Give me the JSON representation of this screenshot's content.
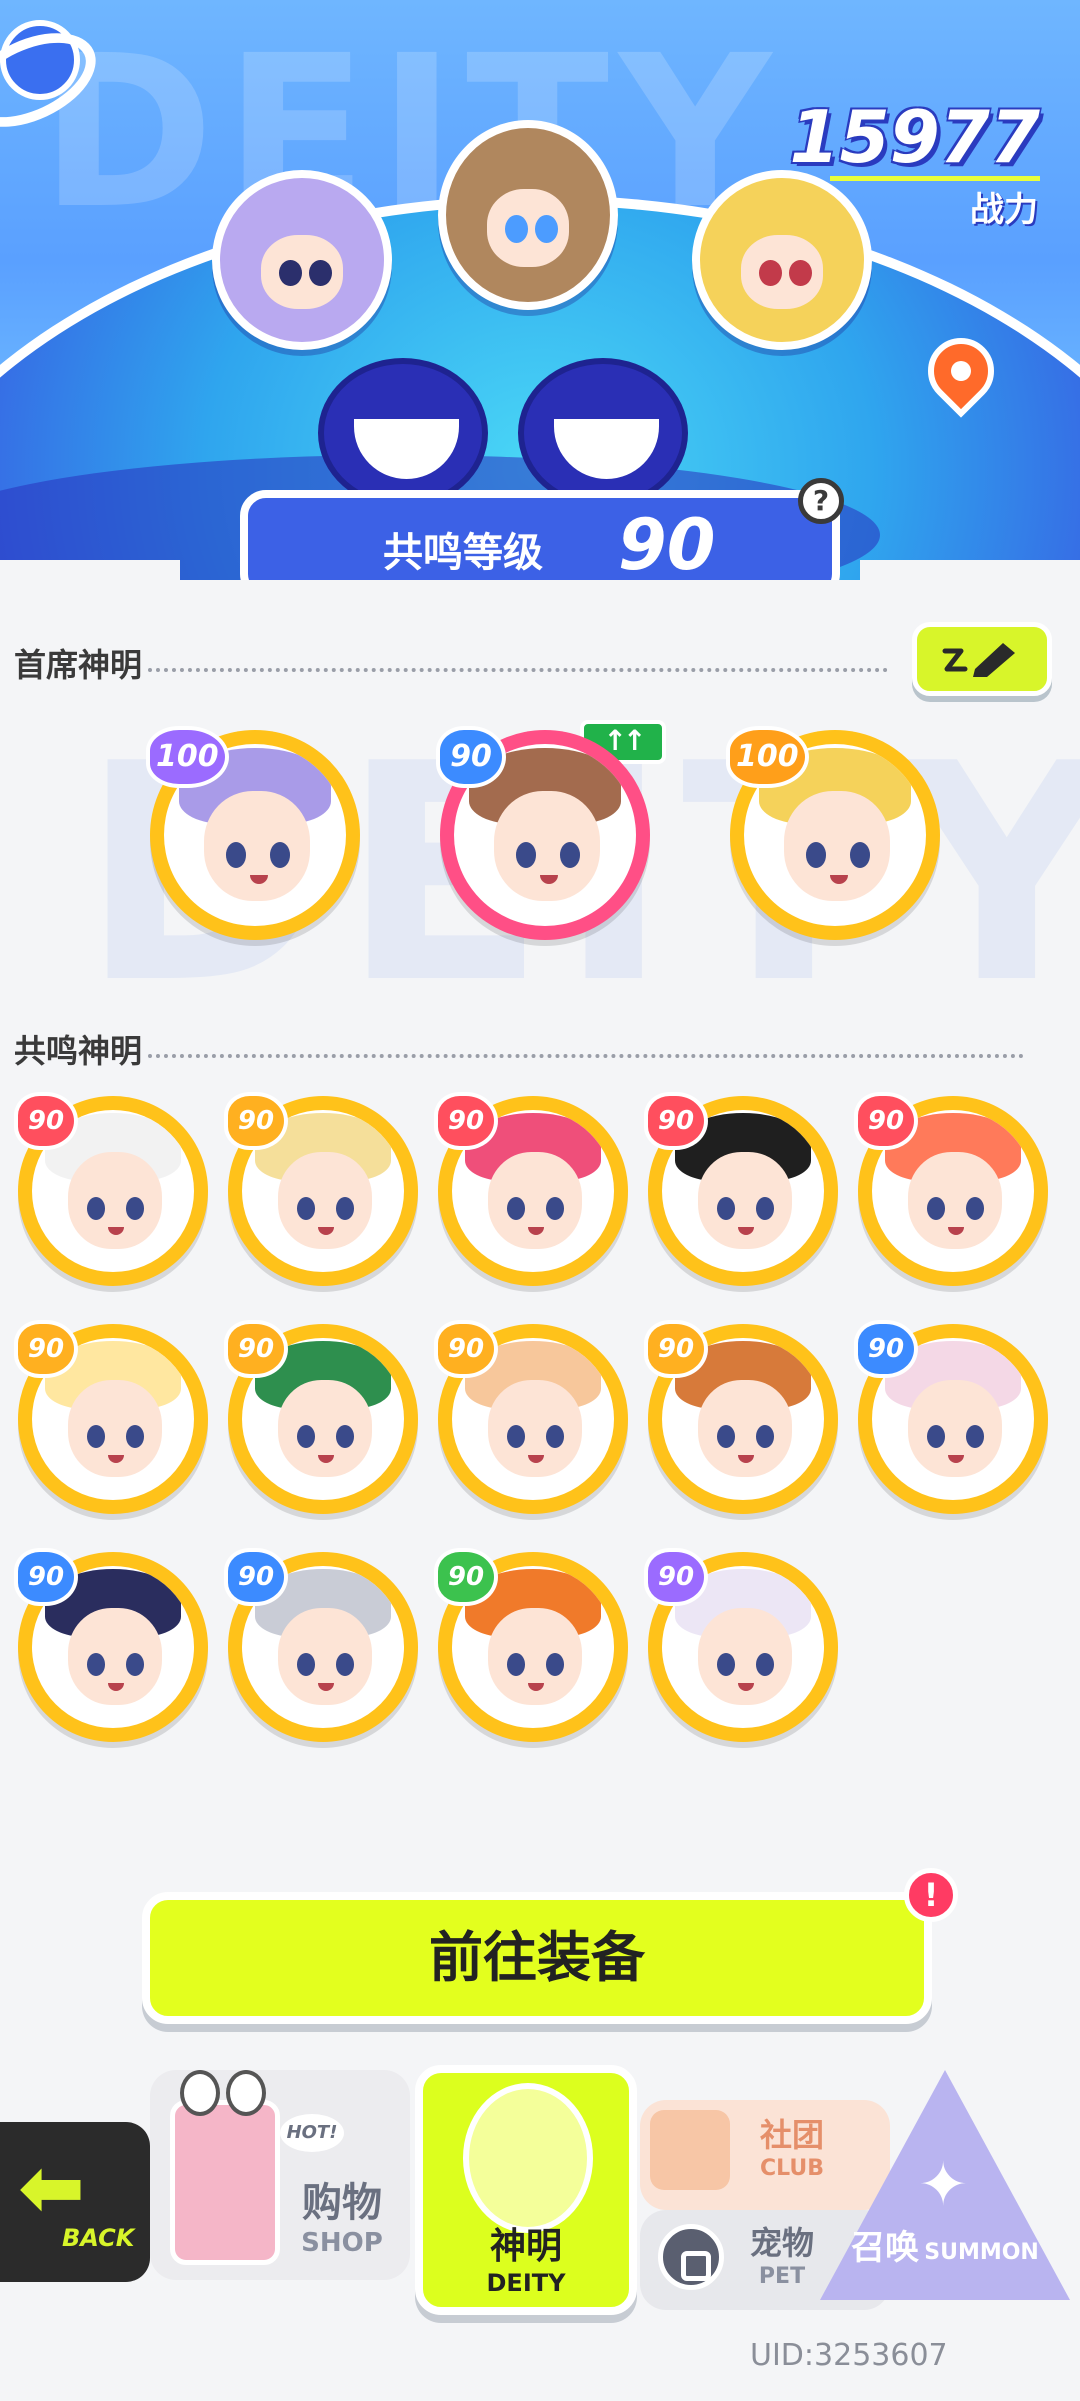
{
  "header": {
    "bg_text": "DEITY",
    "combat_power_value": "15977",
    "combat_power_label": "战力",
    "resonance_label": "共鸣等级",
    "resonance_value": "90",
    "help_glyph": "?"
  },
  "primary": {
    "title": "首席神明",
    "bg_text": "DEITY",
    "up_badge": "↑↑",
    "deities": [
      {
        "level": "100",
        "badge_color": "#9b6bff",
        "ring": "#ffc21a",
        "hair": "#a99be8"
      },
      {
        "level": "90",
        "badge_color": "#3c8bff",
        "ring": "#ff4f86",
        "hair": "#a36b4e"
      },
      {
        "level": "100",
        "badge_color": "#ff9f1a",
        "ring": "#ffc21a",
        "hair": "#f5d25a"
      }
    ]
  },
  "resonance": {
    "title": "共鸣神明",
    "deities": [
      {
        "level": "90",
        "badge_color": "#ff4f5e",
        "hair": "#f2f2f2"
      },
      {
        "level": "90",
        "badge_color": "#ffb020",
        "hair": "#f5df9a"
      },
      {
        "level": "90",
        "badge_color": "#ff4f5e",
        "hair": "#ef4f7a"
      },
      {
        "level": "90",
        "badge_color": "#ff4f5e",
        "hair": "#1f1f1f"
      },
      {
        "level": "90",
        "badge_color": "#ff4f5e",
        "hair": "#ff7a5a"
      },
      {
        "level": "90",
        "badge_color": "#ffb020",
        "hair": "#ffe7a0"
      },
      {
        "level": "90",
        "badge_color": "#ffb020",
        "hair": "#2e8f4e"
      },
      {
        "level": "90",
        "badge_color": "#ffb020",
        "hair": "#f7c79b"
      },
      {
        "level": "90",
        "badge_color": "#ffb020",
        "hair": "#d77a3a"
      },
      {
        "level": "90",
        "badge_color": "#3c8bff",
        "hair": "#f4d8e6"
      },
      {
        "level": "90",
        "badge_color": "#3c8bff",
        "hair": "#2a2d5e"
      },
      {
        "level": "90",
        "badge_color": "#3c8bff",
        "hair": "#c9ccd6"
      },
      {
        "level": "90",
        "badge_color": "#3cc24e",
        "hair": "#f07a2a"
      },
      {
        "level": "90",
        "badge_color": "#9b6bff",
        "hair": "#ece6f5"
      }
    ]
  },
  "equip_button": {
    "label": "前往装备",
    "notify": "!"
  },
  "nav": {
    "back_label": "BACK",
    "shop": {
      "hot": "HOT!",
      "cn": "购物",
      "en": "SHOP"
    },
    "deity": {
      "cn": "神明",
      "en": "DEITY"
    },
    "club": {
      "cn": "社团",
      "en": "CLUB"
    },
    "pet": {
      "cn": "宠物",
      "en": "PET"
    },
    "summon": {
      "cn": "召唤",
      "en": "SUMMON"
    }
  },
  "uid": "UID:3253607",
  "colors": {
    "accent": "#dcff1e",
    "primary_blue": "#3c61e6",
    "ring_gold": "#ffc21a"
  }
}
